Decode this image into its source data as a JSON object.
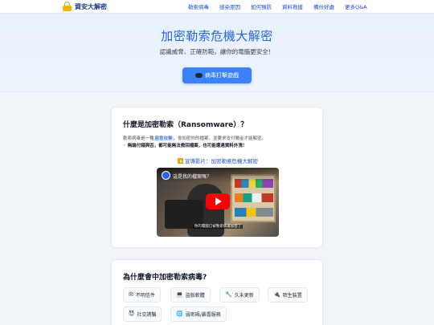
{
  "brand": {
    "name": "資安大解密",
    "icon": "lock-icon"
  },
  "nav": {
    "links": [
      "勒索病毒",
      "感染原因",
      "如何預防",
      "資料救援",
      "備份好處",
      "更多Q&A"
    ]
  },
  "hero": {
    "title": "加密勒索危機大解密",
    "subtitle": "認識威脅、正確防範，讓你的電腦更安全！",
    "cta_label": "病毒打擊遊戲",
    "accent": "#2563eb",
    "button_color": "#3b82f6"
  },
  "what_is": {
    "heading": "什麼是加密勒索（Ransomware）？",
    "para1_before": "勒索病毒是一種",
    "para1_highlight": "惡意攻擊",
    "para1_after": "，會加密你的檔案，並要求支付贖金才能解密。",
    "para2_icon": "⚡",
    "para2": "無論付錢與否，都可能無法救回檔案，也可能遭遇資料外洩！",
    "video_link": "宣導影片：加密勒索危機大解密",
    "video": {
      "title": "這是我的檔案嗎？",
      "caption": "你的電腦已被勒索病毒加密了"
    }
  },
  "why_infected": {
    "heading": "為什麼會中加密勒索病毒?",
    "chips": [
      {
        "icon": "✉",
        "icon_name": "mail-icon",
        "label": "不明信件"
      },
      {
        "icon": "💻",
        "icon_name": "laptop-icon",
        "label": "盜版軟體"
      },
      {
        "icon": "🔧",
        "icon_name": "wrench-icon",
        "label": "久未更新"
      },
      {
        "icon": "🔌",
        "icon_name": "plug-icon",
        "label": "陌生裝置"
      },
      {
        "icon": "😈",
        "icon_name": "devil-icon",
        "label": "社交誘騙"
      },
      {
        "icon": "🌐",
        "icon_name": "globe-icon",
        "label": "弱密碼/暴露服務"
      }
    ]
  }
}
